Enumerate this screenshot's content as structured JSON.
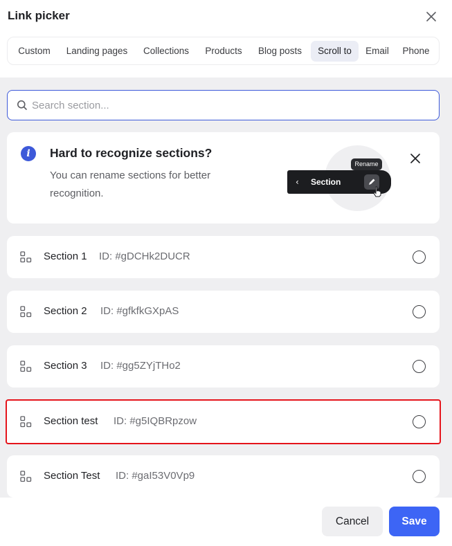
{
  "header": {
    "title": "Link picker"
  },
  "tabs": [
    {
      "label": "Custom",
      "active": false
    },
    {
      "label": "Landing pages",
      "active": false
    },
    {
      "label": "Collections",
      "active": false
    },
    {
      "label": "Products",
      "active": false
    },
    {
      "label": "Blog posts",
      "active": false
    },
    {
      "label": "Scroll to",
      "active": true
    },
    {
      "label": "Email",
      "active": false
    },
    {
      "label": "Phone",
      "active": false
    }
  ],
  "search": {
    "placeholder": "Search section...",
    "value": ""
  },
  "info": {
    "title": "Hard to recognize sections?",
    "description": "You can rename sections for better recognition.",
    "illustration": {
      "bar_label": "Section",
      "tooltip": "Rename"
    }
  },
  "sections": [
    {
      "name": "Section 1",
      "id_text": "ID: #gDCHk2DUCR",
      "selected": false,
      "highlighted": false
    },
    {
      "name": "Section 2",
      "id_text": "ID: #gfkfkGXpAS",
      "selected": false,
      "highlighted": false
    },
    {
      "name": "Section 3",
      "id_text": "ID: #gg5ZYjTHo2",
      "selected": false,
      "highlighted": false
    },
    {
      "name": "Section test",
      "id_text": "ID: #g5IQBRpzow",
      "selected": false,
      "highlighted": true
    },
    {
      "name": "Section Test",
      "id_text": "ID: #gaI53V0Vp9",
      "selected": false,
      "highlighted": false
    }
  ],
  "footer": {
    "cancel_label": "Cancel",
    "save_label": "Save"
  },
  "colors": {
    "accent": "#3d59d9",
    "save_button": "#3d65f5",
    "highlight_border": "#e5141b",
    "content_background": "#efeff1"
  },
  "icons": {
    "close": "close-icon",
    "search": "search-icon",
    "info": "info-icon",
    "section": "section-layout-icon",
    "edit": "pencil-icon",
    "cursor": "hand-cursor-icon"
  }
}
